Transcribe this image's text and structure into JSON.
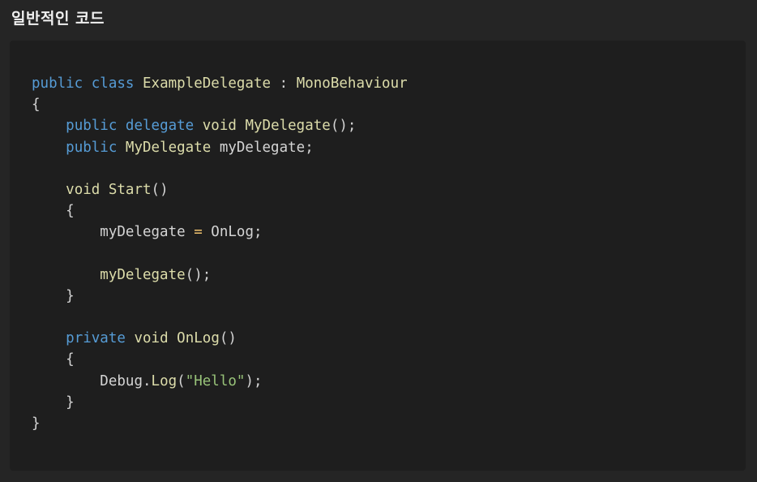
{
  "heading": "일반적인 코드",
  "code": {
    "language": "csharp",
    "lines": [
      [
        {
          "t": "public",
          "k": "kw"
        },
        {
          "t": " ",
          "k": "plain"
        },
        {
          "t": "class",
          "k": "kw"
        },
        {
          "t": " ",
          "k": "plain"
        },
        {
          "t": "ExampleDelegate",
          "k": "type"
        },
        {
          "t": " ",
          "k": "plain"
        },
        {
          "t": ":",
          "k": "punc"
        },
        {
          "t": " ",
          "k": "plain"
        },
        {
          "t": "MonoBehaviour",
          "k": "type"
        }
      ],
      [
        {
          "t": "{",
          "k": "punc"
        }
      ],
      [
        {
          "t": "    ",
          "k": "plain"
        },
        {
          "t": "public",
          "k": "kw"
        },
        {
          "t": " ",
          "k": "plain"
        },
        {
          "t": "delegate",
          "k": "kw"
        },
        {
          "t": " ",
          "k": "plain"
        },
        {
          "t": "void",
          "k": "type"
        },
        {
          "t": " ",
          "k": "plain"
        },
        {
          "t": "MyDelegate",
          "k": "fn"
        },
        {
          "t": "();",
          "k": "punc"
        }
      ],
      [
        {
          "t": "    ",
          "k": "plain"
        },
        {
          "t": "public",
          "k": "kw"
        },
        {
          "t": " ",
          "k": "plain"
        },
        {
          "t": "MyDelegate",
          "k": "type"
        },
        {
          "t": " ",
          "k": "plain"
        },
        {
          "t": "myDelegate",
          "k": "var"
        },
        {
          "t": ";",
          "k": "punc"
        }
      ],
      [],
      [
        {
          "t": "    ",
          "k": "plain"
        },
        {
          "t": "void",
          "k": "type"
        },
        {
          "t": " ",
          "k": "plain"
        },
        {
          "t": "Start",
          "k": "fn"
        },
        {
          "t": "()",
          "k": "punc"
        }
      ],
      [
        {
          "t": "    ",
          "k": "plain"
        },
        {
          "t": "{",
          "k": "punc"
        }
      ],
      [
        {
          "t": "        ",
          "k": "plain"
        },
        {
          "t": "myDelegate",
          "k": "var"
        },
        {
          "t": " ",
          "k": "plain"
        },
        {
          "t": "=",
          "k": "op"
        },
        {
          "t": " ",
          "k": "plain"
        },
        {
          "t": "OnLog",
          "k": "var"
        },
        {
          "t": ";",
          "k": "punc"
        }
      ],
      [],
      [
        {
          "t": "        ",
          "k": "plain"
        },
        {
          "t": "myDelegate",
          "k": "fn"
        },
        {
          "t": "();",
          "k": "punc"
        }
      ],
      [
        {
          "t": "    ",
          "k": "plain"
        },
        {
          "t": "}",
          "k": "punc"
        }
      ],
      [],
      [
        {
          "t": "    ",
          "k": "plain"
        },
        {
          "t": "private",
          "k": "kw"
        },
        {
          "t": " ",
          "k": "plain"
        },
        {
          "t": "void",
          "k": "type"
        },
        {
          "t": " ",
          "k": "plain"
        },
        {
          "t": "OnLog",
          "k": "fn"
        },
        {
          "t": "()",
          "k": "punc"
        }
      ],
      [
        {
          "t": "    ",
          "k": "plain"
        },
        {
          "t": "{",
          "k": "punc"
        }
      ],
      [
        {
          "t": "        ",
          "k": "plain"
        },
        {
          "t": "Debug",
          "k": "var"
        },
        {
          "t": ".",
          "k": "punc"
        },
        {
          "t": "Log",
          "k": "fn"
        },
        {
          "t": "(",
          "k": "punc"
        },
        {
          "t": "\"Hello\"",
          "k": "str"
        },
        {
          "t": ");",
          "k": "punc"
        }
      ],
      [
        {
          "t": "    ",
          "k": "plain"
        },
        {
          "t": "}",
          "k": "punc"
        }
      ],
      [
        {
          "t": "}",
          "k": "punc"
        }
      ]
    ]
  },
  "colors": {
    "page_background": "#252525",
    "code_background": "#1e1e1e",
    "heading_text": "#f0f0f0",
    "keyword": "#569cd6",
    "type_and_function": "#dcdcaa",
    "identifier": "#d4d4d4",
    "operator": "#f0c26e",
    "string": "#98c379"
  }
}
